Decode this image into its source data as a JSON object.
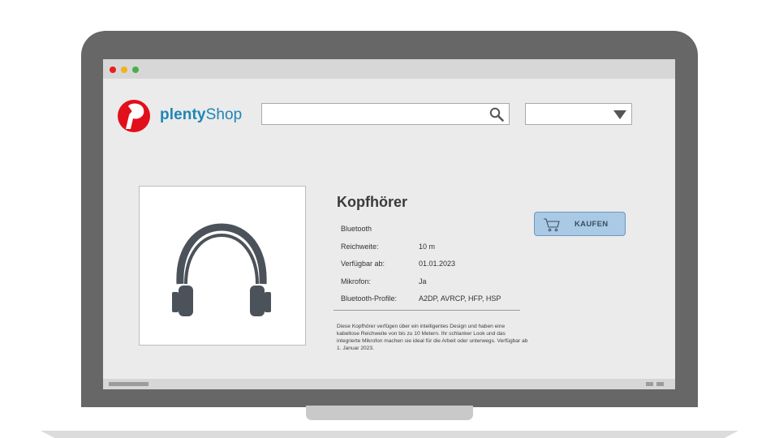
{
  "brand": {
    "name_bold": "plenty",
    "name_regular": "Shop",
    "logo_letter": "p",
    "logo_color": "#e1101b",
    "text_color": "#1e86b5"
  },
  "search": {
    "value": "",
    "placeholder": ""
  },
  "select": {
    "value": ""
  },
  "product": {
    "title": "Kopfhörer",
    "specs": [
      {
        "label": "Bluetooth",
        "value": ""
      },
      {
        "label": "Reichweite:",
        "value": "10 m"
      },
      {
        "label": "Verfügbar ab:",
        "value": "01.01.2023"
      },
      {
        "label": "Mikrofon:",
        "value": "Ja"
      },
      {
        "label": "Bluetooth-Profile:",
        "value": "A2DP, AVRCP, HFP, HSP"
      }
    ],
    "description": "Diese Kopfhörer verfügen über ein intelligentes Design und haben eine kabellose Reichweite von bis zu 10 Metern. Ihr schlanker Look und das integrierte Mikrofon machen sie ideal für die Arbeit oder unterwegs. Verfügbar ab 1. Januar 2023."
  },
  "buy_button": {
    "label": "KAUFEN",
    "icon": "cart-icon",
    "color": "#a9c9e4"
  },
  "window_controls": {
    "close_color": "#ec1d1d",
    "minimize_color": "#f2b21a",
    "maximize_color": "#4aae48"
  },
  "icons": {
    "search": "search-icon",
    "dropdown": "chevron-down-icon",
    "product": "headphone-icon"
  }
}
